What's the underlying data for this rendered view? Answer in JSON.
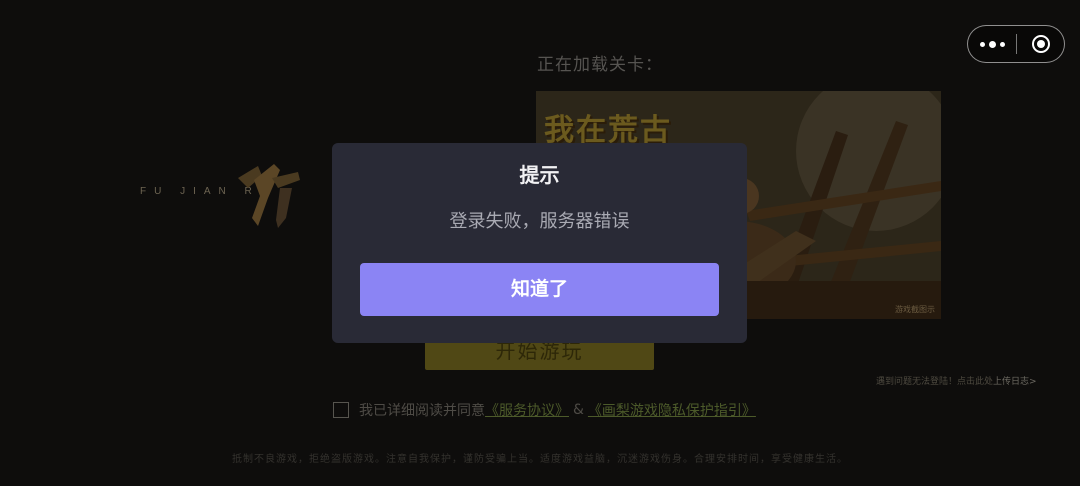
{
  "capsule": {
    "more_icon": "more-dots-icon",
    "close_icon": "close-target-icon"
  },
  "logo": {
    "letters": "FU  JIAN  RU",
    "icon": "game-logo-icon"
  },
  "loading": {
    "label": "正在加载关卡："
  },
  "banner": {
    "title": "我在荒古",
    "tag": "游戏截图示",
    "image": "game-banner-image"
  },
  "start_button": {
    "label": "开始游玩"
  },
  "feedback": {
    "text": "遇到问题无法登陆！点击此处",
    "highlight": "上传日志>"
  },
  "agreement": {
    "prefix": "我已详细阅读并同意",
    "service_link": "《服务协议》",
    "amp": "&",
    "privacy_link": "《画梨游戏隐私保护指引》"
  },
  "health_notice": "抵制不良游戏，拒绝盗版游戏。注意自我保护，谨防受骗上当。适度游戏益脑，沉迷游戏伤身。合理安排时间，享受健康生活。",
  "dialog": {
    "title": "提示",
    "message": "登录失败，服务器错误",
    "confirm_label": "知道了"
  },
  "colors": {
    "dialog_bg": "#292a36",
    "confirm_bg": "#8b84f4",
    "overlay": "#0c0c0c"
  }
}
